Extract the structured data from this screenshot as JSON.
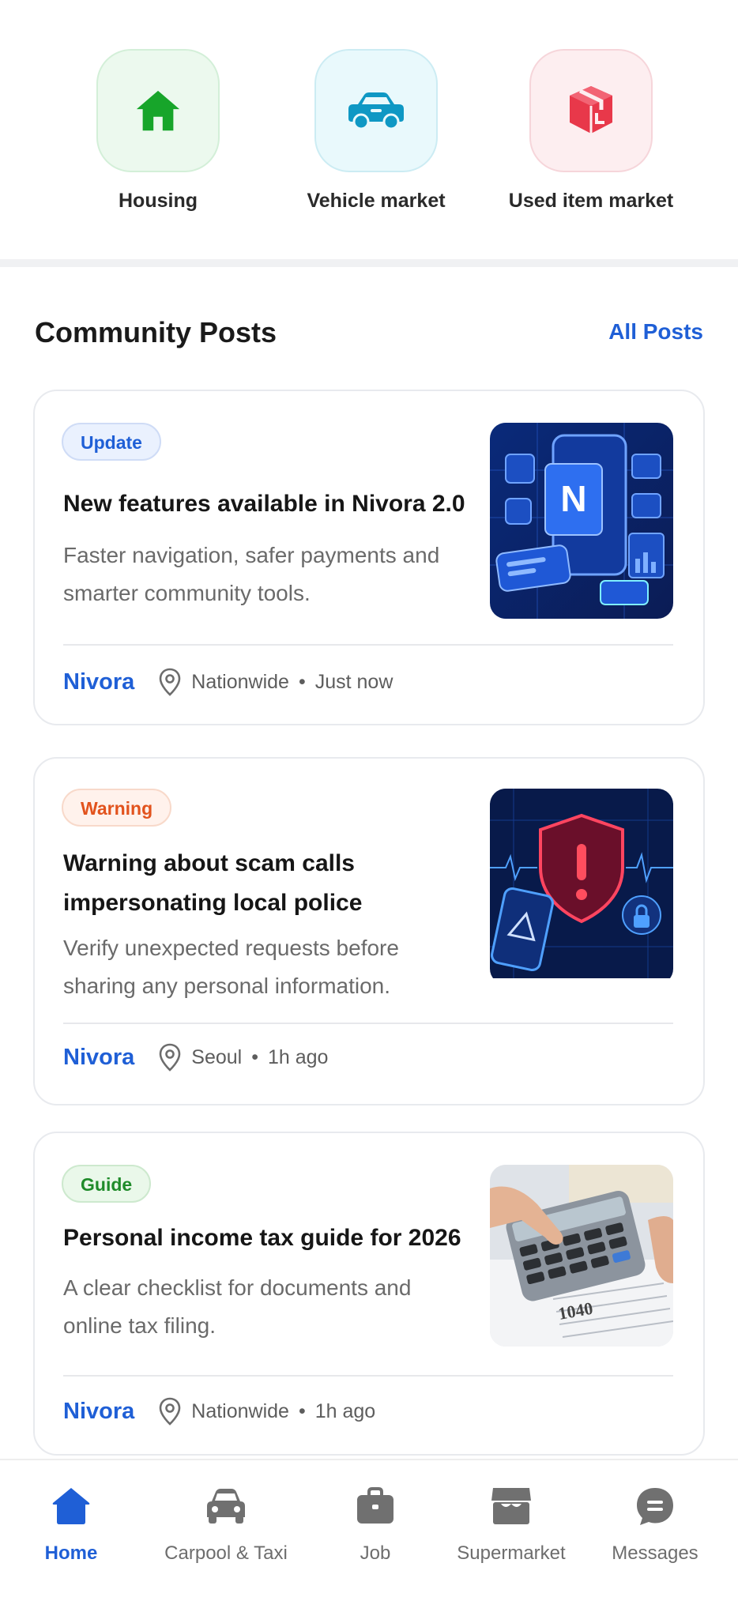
{
  "categories": [
    {
      "label": "Housing",
      "icon": "house-icon",
      "color": "#17a52a",
      "bg": "#ecf9ee"
    },
    {
      "label": "Vehicle market",
      "icon": "car-icon",
      "color": "#0f98c4",
      "bg": "#e9f9fc"
    },
    {
      "label": "Used item market",
      "icon": "package-icon",
      "color": "#e8384a",
      "bg": "#fdeef0"
    }
  ],
  "section": {
    "title": "Community Posts",
    "all_link": "All Posts"
  },
  "posts": [
    {
      "badge": "Update",
      "title": "New features available in Nivora 2.0",
      "description": "Faster navigation, safer payments and smarter community tools.",
      "author": "Nivora",
      "location": "Nationwide",
      "time": "Just now",
      "image": "app-update-illustration"
    },
    {
      "badge": "Warning",
      "title": "Warning about scam calls impersonating local police",
      "description": "Verify unexpected requests before sharing any personal information.",
      "author": "Nivora",
      "location": "Seoul",
      "time": "1h ago",
      "image": "security-shield-illustration"
    },
    {
      "badge": "Guide",
      "title": "Personal income tax guide for 2026",
      "description": "A clear checklist for documents and online tax filing.",
      "author": "Nivora",
      "location": "Nationwide",
      "time": "1h ago",
      "image": "tax-calculator-photo"
    }
  ],
  "bottom_nav": [
    {
      "label": "Home",
      "icon": "home-icon",
      "active": true
    },
    {
      "label": "Carpool & Taxi",
      "icon": "car-icon",
      "active": false
    },
    {
      "label": "Job",
      "icon": "briefcase-icon",
      "active": false
    },
    {
      "label": "Supermarket",
      "icon": "store-icon",
      "active": false
    },
    {
      "label": "Messages",
      "icon": "chat-icon",
      "active": false
    }
  ],
  "colors": {
    "accent": "#1f5fd6",
    "nav_inactive": "#707070"
  }
}
